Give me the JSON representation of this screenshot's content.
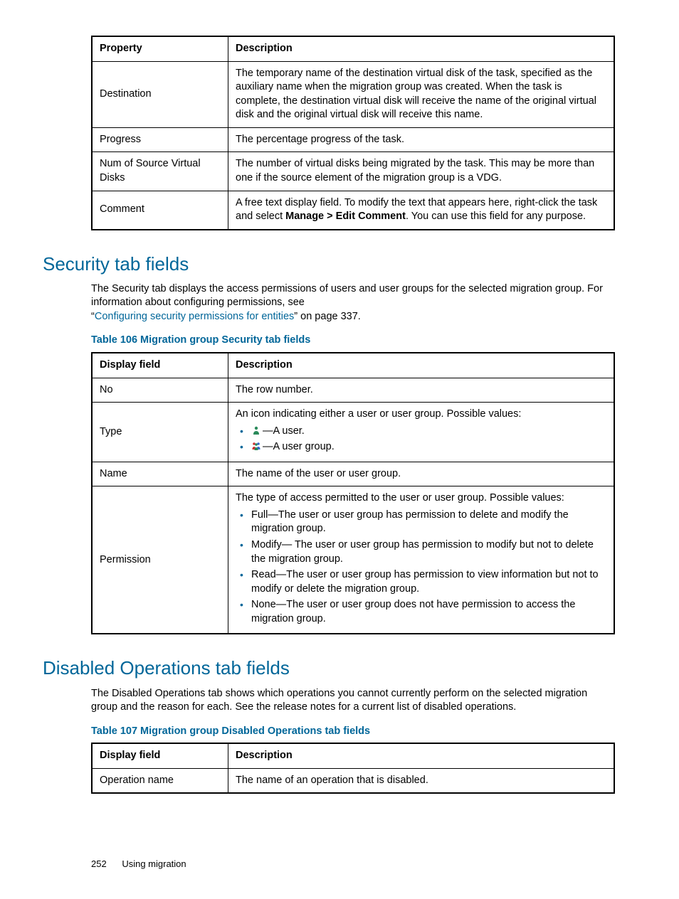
{
  "table1": {
    "headers": [
      "Property",
      "Description"
    ],
    "rows": [
      {
        "p": "Destination",
        "d": "The temporary name of the destination virtual disk of the task, specified as the auxiliary name when the migration group was created. When the task is complete, the destination virtual disk will receive the name of the original virtual disk and the original virtual disk will receive this name."
      },
      {
        "p": "Progress",
        "d": "The percentage progress of the task."
      },
      {
        "p": "Num of Source Virtual Disks",
        "d": "The number of virtual disks being migrated by the task. This may be more than one if the source element of the migration group is a VDG."
      },
      {
        "p": "Comment",
        "d_pre": "A free text display field. To modify the text that appears here, right-click the task and select ",
        "d_bold": "Manage > Edit Comment",
        "d_post": ". You can use this field for any purpose."
      }
    ]
  },
  "section_security": {
    "title": "Security tab fields",
    "para_pre": "The Security tab displays the access permissions of users and user groups for the selected migration group. For information about configuring permissions, see",
    "quote_open": "“",
    "link_text": "Configuring security permissions for entities",
    "quote_close": "” on page 337.",
    "caption": "Table 106 Migration group Security tab fields",
    "headers": [
      "Display field",
      "Description"
    ],
    "row_no": {
      "p": "No",
      "d": "The row number."
    },
    "row_type": {
      "p": "Type",
      "lead": "An icon indicating either a user or user group. Possible values:",
      "b1": "—A user.",
      "b2": "—A user group."
    },
    "row_name": {
      "p": "Name",
      "d": "The name of the user or user group."
    },
    "row_perm": {
      "p": "Permission",
      "lead": "The type of access permitted to the user or user group. Possible values:",
      "b1": "Full—The user or user group has permission to delete and modify the migration group.",
      "b2": "Modify— The user or user group has permission to modify but not to delete the migration group.",
      "b3": "Read—The user or user group has permission to view information but not to modify or delete the migration group.",
      "b4": "None—The user or user group does not have permission to access the migration group."
    }
  },
  "section_disabled": {
    "title": "Disabled Operations tab fields",
    "para": "The Disabled Operations tab shows which operations you cannot currently perform on the selected migration group and the reason for each. See the release notes for a current list of disabled operations.",
    "caption": "Table 107 Migration group Disabled Operations tab fields",
    "headers": [
      "Display field",
      "Description"
    ],
    "row": {
      "p": "Operation name",
      "d": "The name of an operation that is disabled."
    }
  },
  "footer": {
    "page": "252",
    "chapter": "Using migration"
  }
}
